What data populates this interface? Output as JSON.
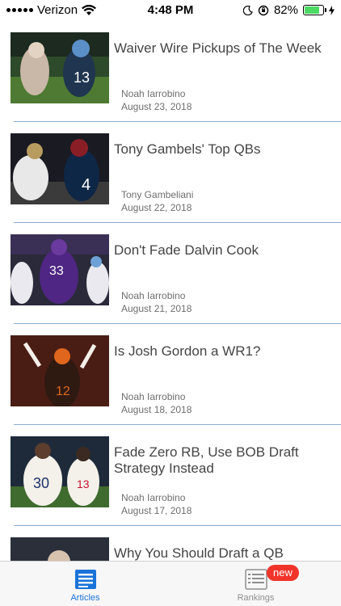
{
  "status_bar": {
    "carrier": "Verizon",
    "time": "4:48 PM",
    "battery_percent": "82%",
    "battery_level": 0.82,
    "icons": [
      "wifi-icon",
      "moon-icon",
      "rotation-lock-icon",
      "battery-icon",
      "charging-icon"
    ]
  },
  "articles": [
    {
      "title": "Waiver Wire Pickups of The Week",
      "author": "Noah Iarrobino",
      "date": "August 23, 2018"
    },
    {
      "title": "Tony Gambels' Top QBs",
      "author": "Tony Gambeliani",
      "date": "August 22, 2018"
    },
    {
      "title": "Don't Fade Dalvin Cook",
      "author": "Noah Iarrobino",
      "date": "August 21, 2018"
    },
    {
      "title": "Is Josh Gordon a WR1?",
      "author": "Noah Iarrobino",
      "date": "August 18, 2018"
    },
    {
      "title": "Fade Zero RB, Use BOB Draft Strategy Instead",
      "author": "Noah Iarrobino",
      "date": "August 17, 2018"
    },
    {
      "title": "Why You Should Draft a QB",
      "author": "",
      "date": ""
    }
  ],
  "tabbar": {
    "articles_label": "Articles",
    "rankings_label": "Rankings",
    "new_badge": "new",
    "active_color": "#1a73d9",
    "inactive_color": "#8e8e8e",
    "badge_color": "#f0342a"
  }
}
